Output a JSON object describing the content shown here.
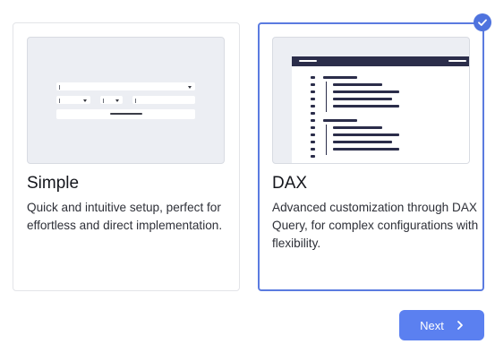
{
  "options": [
    {
      "id": "simple",
      "title": "Simple",
      "description": "Quick and intuitive setup, perfect for effortless and direct implementation.",
      "selected": false
    },
    {
      "id": "dax",
      "title": "DAX",
      "description": "Advanced customization through DAX Query, for complex configurations with flexibility.",
      "selected": true
    }
  ],
  "next_button": {
    "label": "Next",
    "icon": "chevron-right-icon"
  },
  "selected_badge_icon": "check-icon",
  "colors": {
    "accent": "#5b80f0",
    "selected_border": "#5b7be0",
    "code_dark": "#2b2d4a",
    "preview_bg": "#eceef3"
  }
}
